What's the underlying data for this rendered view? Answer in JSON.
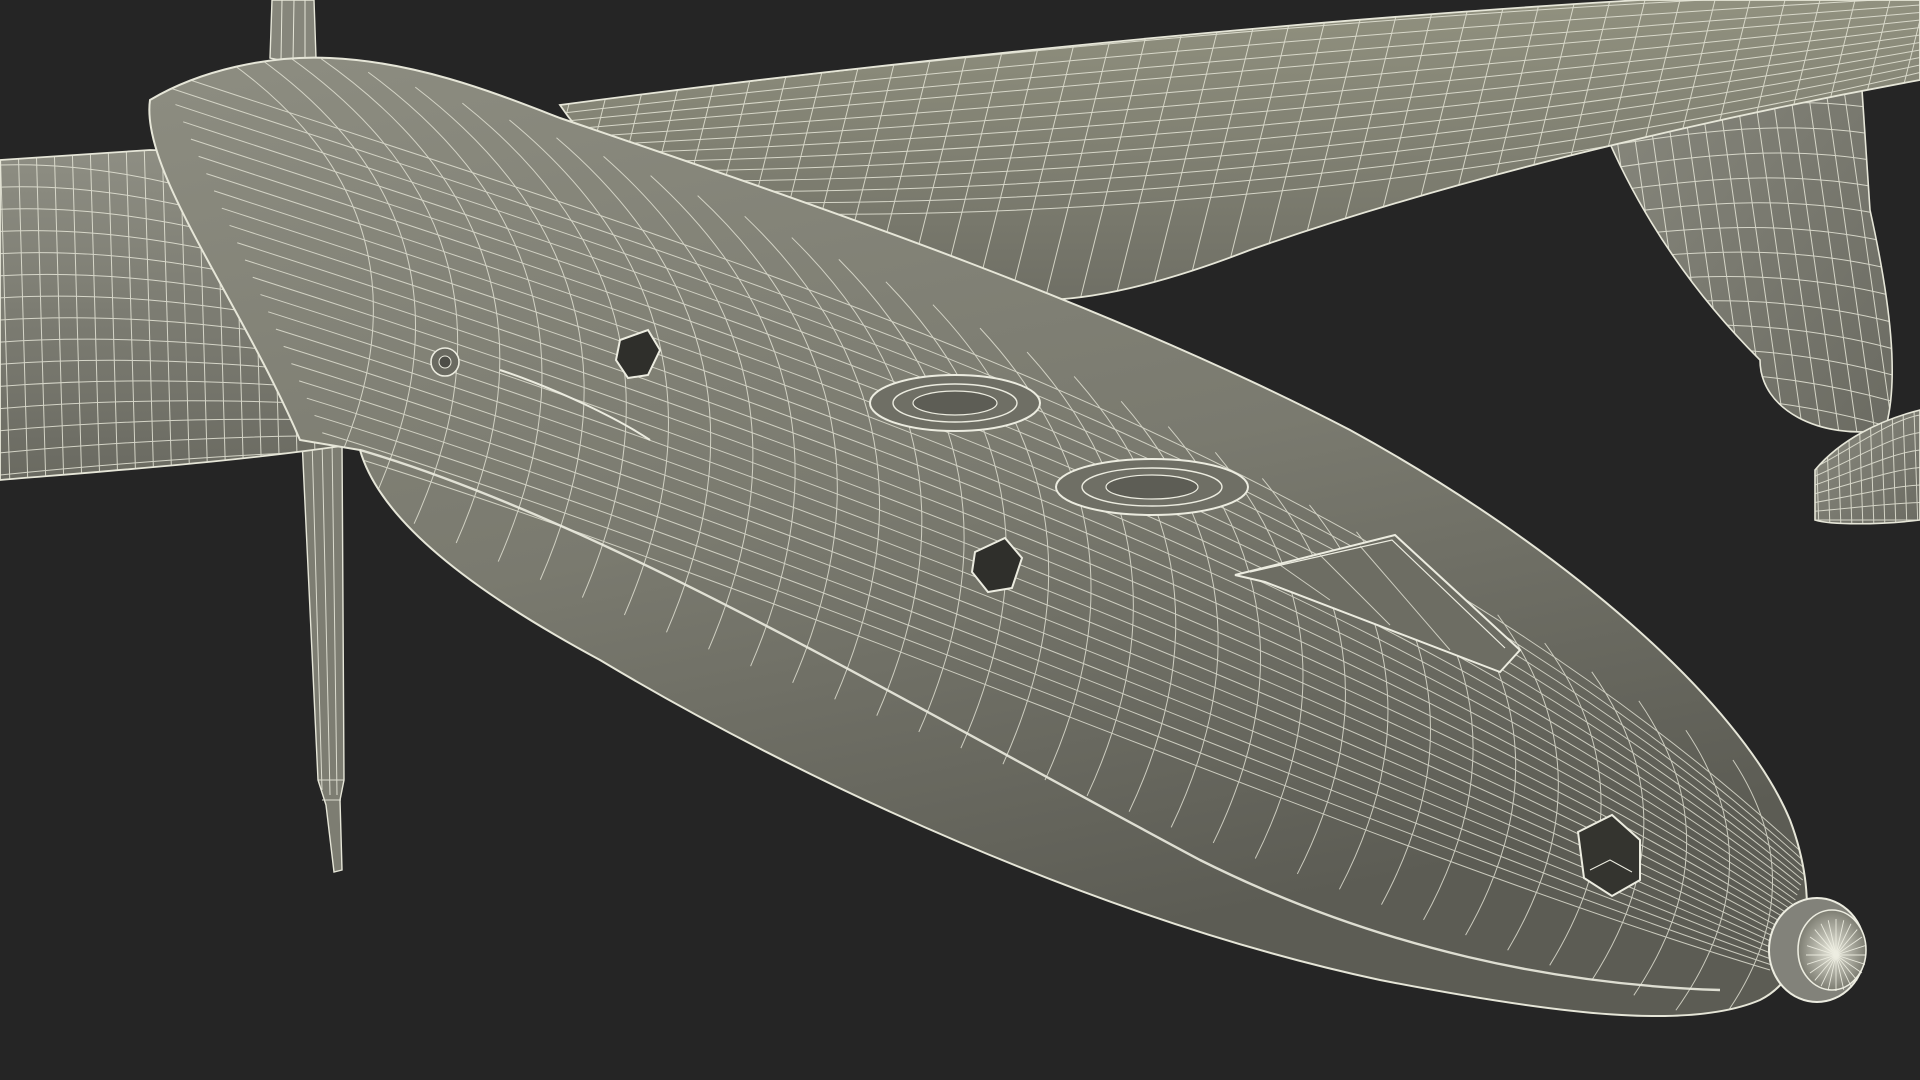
{
  "scene": {
    "subject": "drone-wireframe-model",
    "render_style": "wireframe-over-shaded"
  },
  "colors": {
    "background": "#252525",
    "surface_light": "#8c8c80",
    "surface_mid": "#7a7a6f",
    "surface_dark": "#5f5f56",
    "wire": "#e6e6d8",
    "hole_dark": "#2f2f2b"
  },
  "parts": [
    "fuselage",
    "nose-cap",
    "main-wing",
    "left-wing",
    "tail-fin",
    "tail-tip",
    "upper-antenna",
    "lower-antenna",
    "sensor-ports",
    "top-hatch"
  ]
}
